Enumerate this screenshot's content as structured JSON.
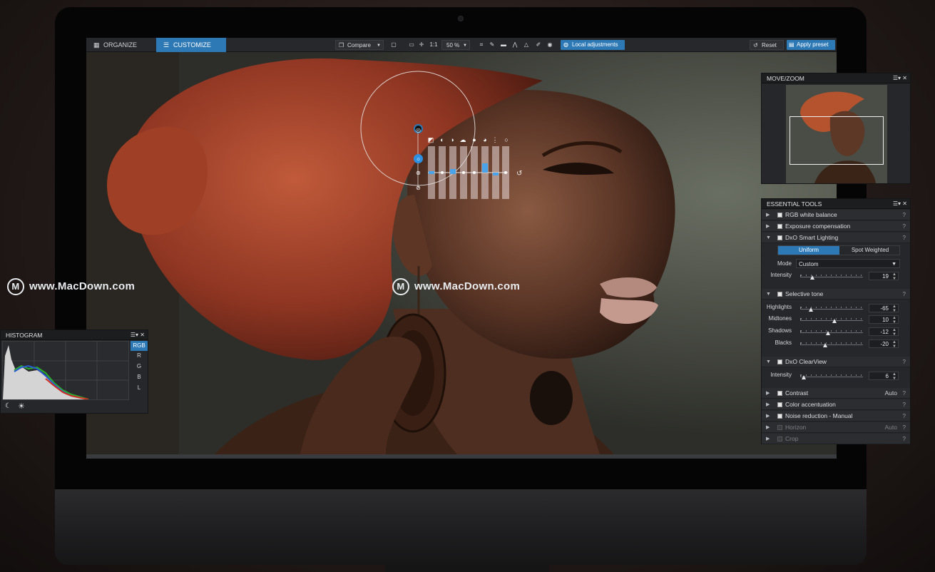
{
  "toolbar": {
    "tabs": [
      {
        "label": "ORGANIZE",
        "icon": "grid-icon"
      },
      {
        "label": "CUSTOMIZE",
        "icon": "sliders-icon"
      }
    ],
    "compare_label": "Compare",
    "ratio_label": "1:1",
    "zoom_value": "50 %",
    "local_adjustments_label": "Local adjustments",
    "reset_label": "Reset",
    "apply_preset_label": "Apply preset",
    "accent_color": "#2d79b6"
  },
  "move_zoom": {
    "title": "MOVE/ZOOM"
  },
  "essential_tools": {
    "title": "ESSENTIAL TOOLS",
    "rows": [
      {
        "label": "RGB white balance",
        "value": ""
      },
      {
        "label": "Exposure compensation",
        "value": ""
      },
      {
        "label": "DxO Smart Lighting",
        "value": ""
      }
    ],
    "smart_lighting": {
      "modes": [
        "Uniform",
        "Spot Weighted"
      ],
      "mode_label": "Mode",
      "mode_value": "Custom",
      "intensity_label": "Intensity",
      "intensity_value": "19",
      "intensity_level": 0.19
    },
    "selective_tone": {
      "label": "Selective tone",
      "sliders": [
        {
          "label": "Highlights",
          "value": "-65",
          "level": 0.175
        },
        {
          "label": "Midtones",
          "value": "10",
          "level": 0.55
        },
        {
          "label": "Shadows",
          "value": "-12",
          "level": 0.44
        },
        {
          "label": "Blacks",
          "value": "-20",
          "level": 0.4
        }
      ]
    },
    "clearview": {
      "label": "DxO ClearView",
      "intensity_label": "Intensity",
      "intensity_value": "6",
      "intensity_level": 0.06
    },
    "bottom_rows": [
      {
        "label": "Contrast",
        "value": "Auto",
        "enabled": true
      },
      {
        "label": "Color accentuation",
        "value": "",
        "enabled": true
      },
      {
        "label": "Noise reduction - Manual",
        "value": "",
        "enabled": true
      },
      {
        "label": "Horizon",
        "value": "Auto",
        "enabled": false
      },
      {
        "label": "Crop",
        "value": "",
        "enabled": false
      }
    ],
    "help": "?"
  },
  "histogram": {
    "title": "HISTOGRAM",
    "channels": [
      "RGB",
      "R",
      "G",
      "B",
      "L"
    ],
    "selected_channel": "RGB"
  },
  "watermark": {
    "text": "www.MacDown.com",
    "logo": "M"
  }
}
